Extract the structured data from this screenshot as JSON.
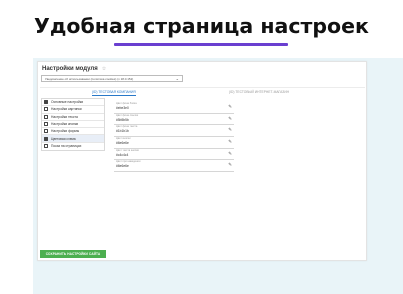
{
  "headline": "Удобная страница настроек",
  "colors": {
    "accent_underline": "#6a3fd0",
    "save_button": "#4caf50",
    "active_tab": "#2878c8"
  },
  "window": {
    "title": "Настройки модуля",
    "star_icon": "star-icon",
    "dropdown_value": "Уведомление об использовании (политика cookies) (v 18.0.152)"
  },
  "tabs": [
    {
      "label": "(ID) ТЕСТОВАЯ КОМПАНИЯ",
      "active": true
    },
    {
      "label": "(ID) ТЕСТОВЫЙ ИНТЕРНЕТ-МАГАЗИН",
      "active": false
    }
  ],
  "sidebar": {
    "items": [
      {
        "label": "Основные настройки",
        "icon": "settings-icon"
      },
      {
        "label": "Настройки картинки",
        "icon": "image-icon"
      },
      {
        "label": "Настройки текста",
        "icon": "text-icon"
      },
      {
        "label": "Настройки кнопки",
        "icon": "button-icon"
      },
      {
        "label": "Настройки формы",
        "icon": "form-icon"
      },
      {
        "label": "Цветовая схема",
        "icon": "palette-icon",
        "active": true
      },
      {
        "label": "Показ на страницах",
        "icon": "pages-icon"
      }
    ]
  },
  "fields": [
    {
      "label": "Цвет фона блока",
      "value": "#ebe3e0"
    },
    {
      "label": "Цвет фона ссылки",
      "value": "#5b5b5b"
    },
    {
      "label": "Цвет фона текста",
      "value": "#1b1b1b"
    },
    {
      "label": "Цвет кнопки",
      "value": "#6e6e6e"
    },
    {
      "label": "Цвет текста кнопки",
      "value": "#c4c4c4"
    },
    {
      "label": "Цвет при наведении",
      "value": "#6e6e6e"
    }
  ],
  "save_label": "СОХРАНИТЬ НАСТРОЙКИ САЙТА"
}
